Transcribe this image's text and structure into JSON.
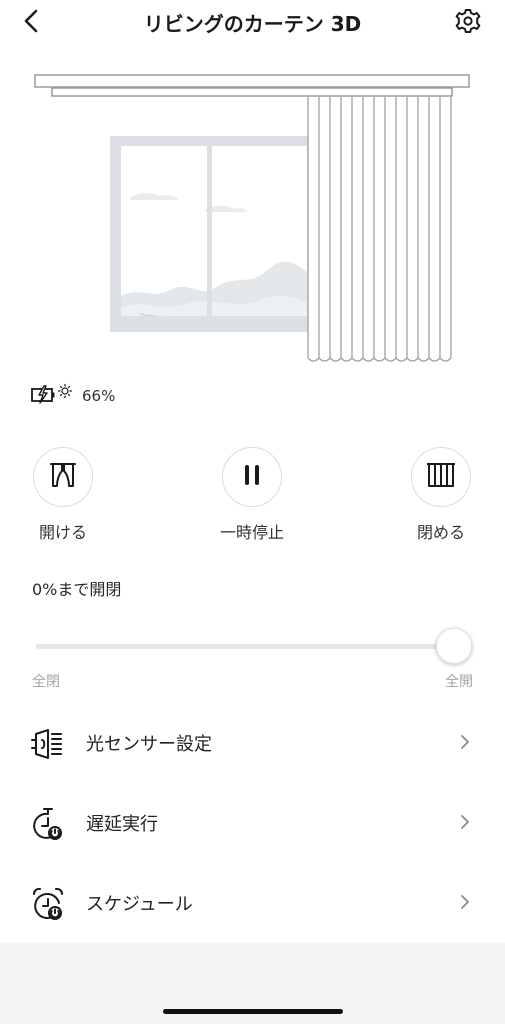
{
  "header": {
    "title": "リビングのカーテン 3D",
    "back_icon": "chevron-left-icon",
    "settings_icon": "gear-icon"
  },
  "status": {
    "battery_icon": "solar-battery-icon",
    "battery_percent": "66%"
  },
  "controls": [
    {
      "label": "開ける",
      "icon": "curtain-open-icon"
    },
    {
      "label": "一時停止",
      "icon": "pause-icon"
    },
    {
      "label": "閉める",
      "icon": "curtain-closed-icon"
    }
  ],
  "slider": {
    "position_text": "0%まで開閉",
    "min_label": "全閉",
    "max_label": "全開",
    "value_fraction": 1.0
  },
  "menu": [
    {
      "label": "光センサー設定",
      "icon": "light-sensor-icon"
    },
    {
      "label": "遅延実行",
      "icon": "timer-icon"
    },
    {
      "label": "スケジュール",
      "icon": "alarm-clock-icon"
    }
  ],
  "colors": {
    "text": "#1e1e1e",
    "secondary_text": "#a6a6a6",
    "track": "#e6e6e6",
    "bottom_bar": "#f5f5f5"
  }
}
